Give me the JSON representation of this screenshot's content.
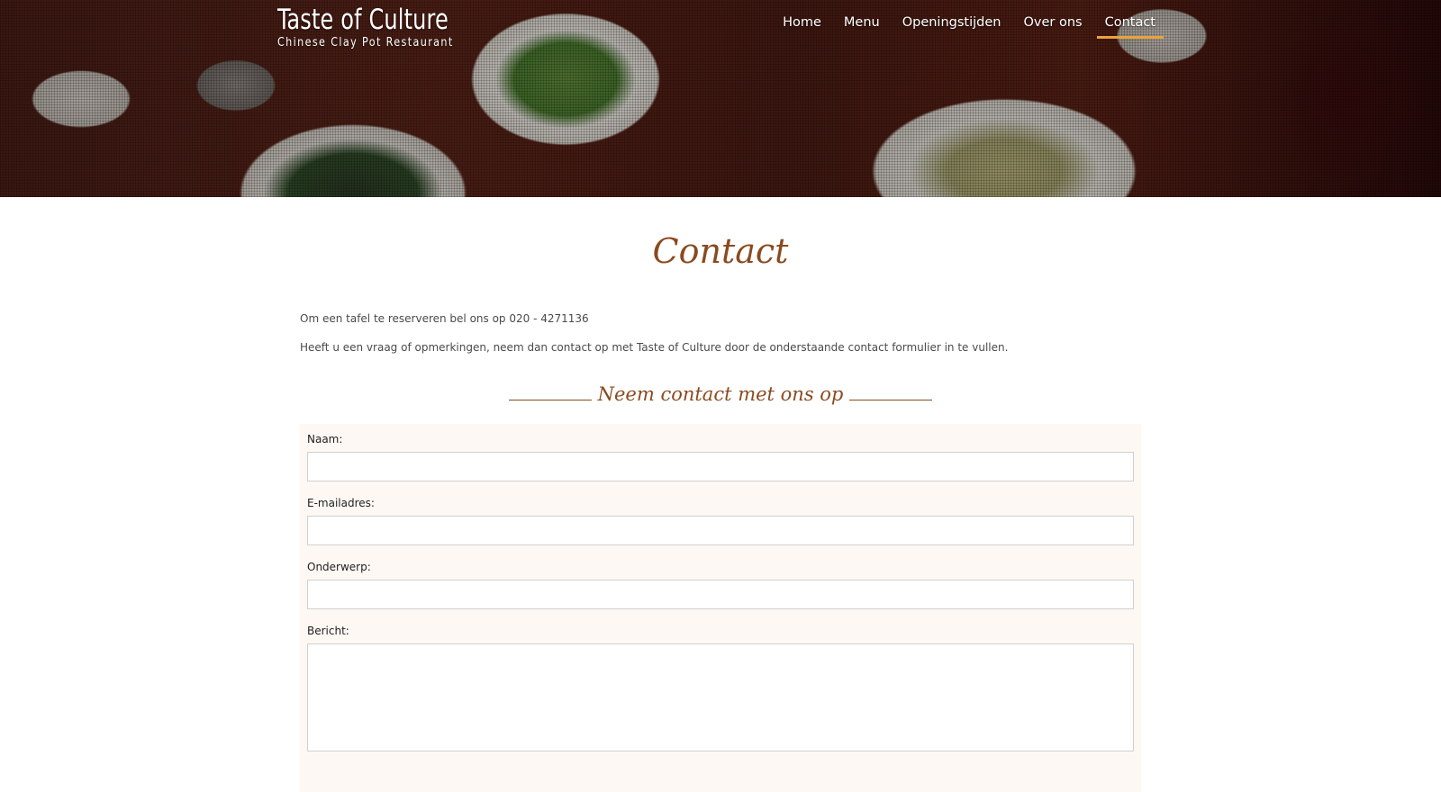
{
  "header": {
    "brand_title": "Taste of Culture",
    "brand_subtitle": "Chinese Clay Pot Restaurant",
    "nav": [
      {
        "label": "Home",
        "active": false
      },
      {
        "label": "Menu",
        "active": false
      },
      {
        "label": "Openingstijden",
        "active": false
      },
      {
        "label": "Over ons",
        "active": false
      },
      {
        "label": "Contact",
        "active": true
      }
    ],
    "accent_color": "#e9a23b"
  },
  "page": {
    "title": "Contact",
    "title_color": "#8a4a1f",
    "intro_line_1": "Om een tafel te reserveren bel ons op  020 - 4271136",
    "intro_line_2": "Heeft u een vraag of opmerkingen, neem dan contact op met Taste of Culture door de onderstaande contact formulier in te vullen."
  },
  "form": {
    "heading": "Neem contact met ons op",
    "fields": [
      {
        "label": "Naam:",
        "value": ""
      },
      {
        "label": "E-mailadres:",
        "value": ""
      },
      {
        "label": "Onderwerp:",
        "value": ""
      },
      {
        "label": "Bericht:",
        "value": ""
      }
    ]
  }
}
